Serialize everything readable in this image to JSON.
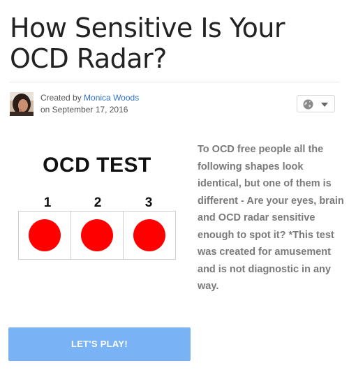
{
  "header": {
    "title": "How Sensitive Is Your OCD Radar?"
  },
  "byline": {
    "created_by_prefix": "Created by",
    "author": "Monica Woods",
    "date": "on September 17, 2016"
  },
  "share": {
    "icon": "globe-icon",
    "dropdown_icon": "caret-down-icon"
  },
  "quiz_image": {
    "title": "OCD TEST",
    "numbers": [
      "1",
      "2",
      "3"
    ],
    "dot_color": "#ff0000"
  },
  "description": {
    "text": "To OCD free people all the following shapes look identical, but one of them is different - Are your eyes, brain and OCD radar sensitive enough to spot it? *This test was created for amusement and is not diagnostic in any way."
  },
  "cta": {
    "label": "LET'S PLAY!",
    "color": "#79b2f5"
  }
}
